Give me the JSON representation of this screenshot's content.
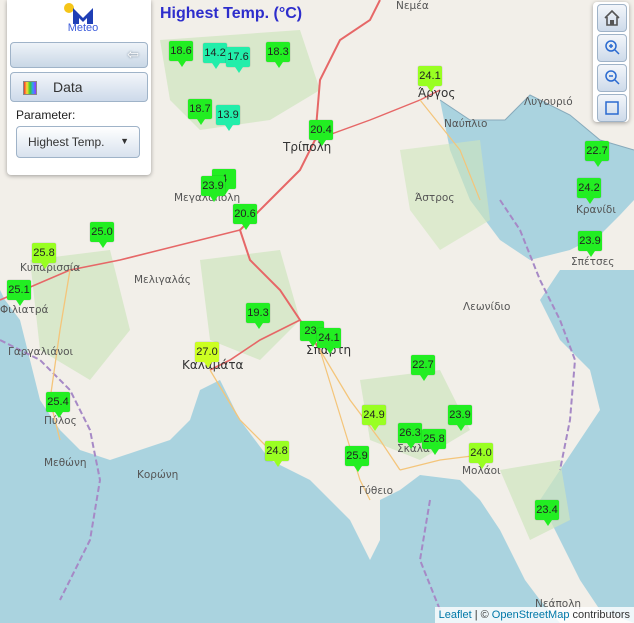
{
  "app": {
    "logo_text": "Meteo",
    "map_title": "Highest Temp. (°C)"
  },
  "panel": {
    "data_label": "Data",
    "parameter_label": "Parameter:",
    "parameter_value": "Highest Temp."
  },
  "toolbar": {
    "icons": [
      "home-icon",
      "zoom-in-icon",
      "zoom-out-icon",
      "fullscreen-icon"
    ]
  },
  "attribution": {
    "leaflet": "Leaflet",
    "sep": "| ©",
    "osm": "OpenStreetMap",
    "contributors": "contributors"
  },
  "colors": {
    "title": "#2d2dcc",
    "marker_green": "#22ee22",
    "marker_lime": "#99ff22",
    "marker_teal": "#22eeaa",
    "marker_yellow": "#ccff22"
  },
  "places": [
    "Νεμέα",
    "Άργος",
    "Λυγουριό",
    "Ναύπλιο",
    "Τρίπολη",
    "Άστρος",
    "Μεγαλόπολη",
    "Κρανίδι",
    "Σπέτσες",
    "Κυπαρισσία",
    "Φιλιατρά",
    "Μελιγαλάς",
    "Λεωνίδιο",
    "Γαργαλιάνοι",
    "Καλαμάτα",
    "Σπάρτη",
    "Πύλος",
    "Μεθώνη",
    "Κορώνη",
    "Σκάλα",
    "Μολάοι",
    "Γύθειο",
    "Νεάπολη"
  ],
  "stations": [
    {
      "value": "18.6",
      "level": "green"
    },
    {
      "value": "14.2",
      "level": "teal"
    },
    {
      "value": "17.6",
      "level": "teal"
    },
    {
      "value": "18.3",
      "level": "green"
    },
    {
      "value": "24.1",
      "level": "lime"
    },
    {
      "value": "18.7",
      "level": "green"
    },
    {
      "value": "13.9",
      "level": "teal"
    },
    {
      "value": "20.4",
      "level": "green"
    },
    {
      "value": "22.7",
      "level": "green"
    },
    {
      "value": "24.2",
      "level": "green"
    },
    {
      "value": "4",
      "level": "green"
    },
    {
      "value": "23.9",
      "level": "green"
    },
    {
      "value": "20.6",
      "level": "green"
    },
    {
      "value": "25.0",
      "level": "green"
    },
    {
      "value": "25.8",
      "level": "lime"
    },
    {
      "value": "23.9",
      "level": "green"
    },
    {
      "value": "25.1",
      "level": "green"
    },
    {
      "value": "19.3",
      "level": "green"
    },
    {
      "value": "23.",
      "level": "green"
    },
    {
      "value": "24.1",
      "level": "green"
    },
    {
      "value": "27.0",
      "level": "yellow"
    },
    {
      "value": "22.7",
      "level": "green"
    },
    {
      "value": "25.4",
      "level": "green"
    },
    {
      "value": "24.9",
      "level": "lime"
    },
    {
      "value": "23.9",
      "level": "green"
    },
    {
      "value": "26.3",
      "level": "green"
    },
    {
      "value": "25.8",
      "level": "green"
    },
    {
      "value": "24.8",
      "level": "lime"
    },
    {
      "value": "25.9",
      "level": "green"
    },
    {
      "value": "24.0",
      "level": "lime"
    },
    {
      "value": "23.4",
      "level": "green"
    }
  ]
}
